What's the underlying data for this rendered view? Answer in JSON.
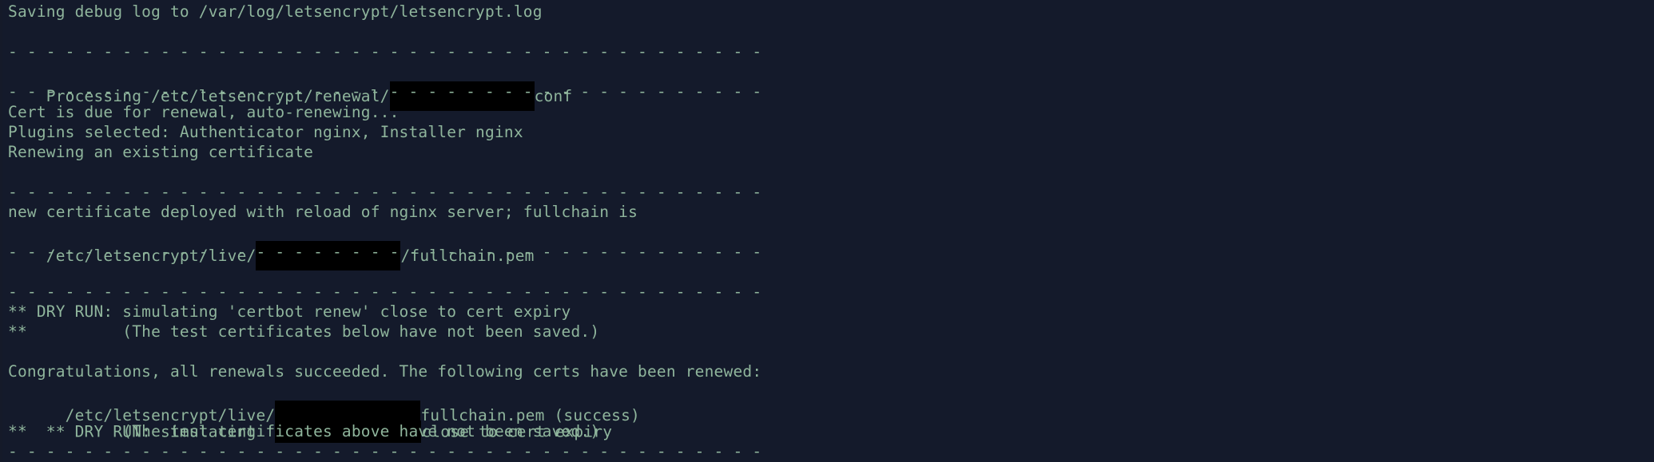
{
  "terminal": {
    "lines": {
      "l0": "Saving debug log to /var/log/letsencrypt/letsencrypt.log",
      "l1": "",
      "l2": "- - - - - - - - - - - - - - - - - - - - - - - - - - - - - - - - - - - - - - - -",
      "l3a": "Processing /etc/letsencrypt/renewal/",
      "l3b": "conf",
      "l4": "- - - - - - - - - - - - - - - - - - - - - - - - - - - - - - - - - - - - - - - -",
      "l5": "Cert is due for renewal, auto-renewing...",
      "l6": "Plugins selected: Authenticator nginx, Installer nginx",
      "l7": "Renewing an existing certificate",
      "l8": "",
      "l9": "- - - - - - - - - - - - - - - - - - - - - - - - - - - - - - - - - - - - - - - -",
      "l10": "new certificate deployed with reload of nginx server; fullchain is",
      "l11a": "/etc/letsencrypt/live/",
      "l11b": "/fullchain.pem",
      "l12": "- - - - - - - - - - - - - - - - - - - - - - - - - - - - - - - - - - - - - - - -",
      "l13": "",
      "l14": "- - - - - - - - - - - - - - - - - - - - - - - - - - - - - - - - - - - - - - - -",
      "l15": "** DRY RUN: simulating 'certbot renew' close to cert expiry",
      "l16": "**          (The test certificates below have not been saved.)",
      "l17": "",
      "l18": "Congratulations, all renewals succeeded. The following certs have been renewed:",
      "l19a": "  /etc/letsencrypt/live/",
      "l19b": "fullchain.pem (success)",
      "l20a": "** DRY RUN: simulating '",
      "l20b": "close to cert expiry",
      "l21": "**          (The test certificates above have not been saved.)",
      "l22": "- - - - - - - - - - - - - - - - - - - - - - - - - - - - - - - - - - - - - - - -"
    }
  }
}
